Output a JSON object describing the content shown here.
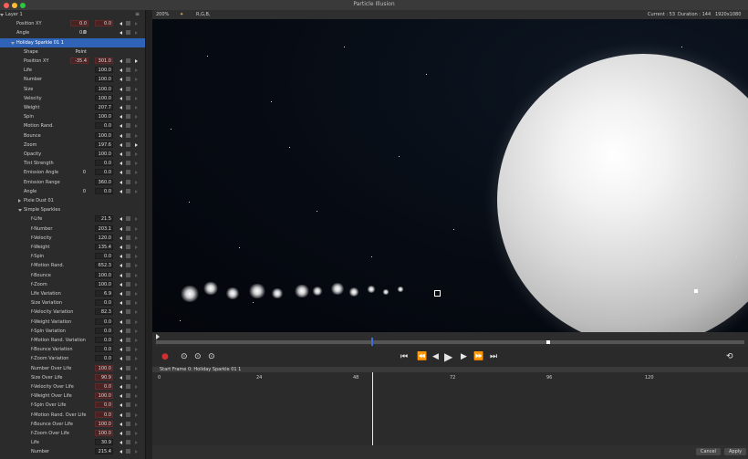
{
  "app": {
    "title": "Particle Illusion"
  },
  "toolbar": {
    "zoom": "200%",
    "mode": "R,G,B,",
    "current": "Current : 53",
    "duration": "Duration : 144",
    "resolution": "1920x1080"
  },
  "layers": [
    {
      "label": "Layer 1",
      "indent": 6,
      "tri": "down"
    },
    {
      "label": "Position XY",
      "indent": 18,
      "v1": "0.0",
      "v2": "0.0",
      "red": true,
      "kf": true,
      "sq": true,
      "ar": "off"
    },
    {
      "label": "Angle",
      "indent": 18,
      "v0": "0",
      "v1": "0.0",
      "kf": true,
      "sq": true,
      "ar": "off"
    },
    {
      "label": "Holiday Sparkle 01 1",
      "indent": 18,
      "tri": "down",
      "selected": true
    },
    {
      "label": "Shape",
      "indent": 26,
      "v1": "Point"
    },
    {
      "label": "Position XY",
      "indent": 26,
      "v1": "-35.4",
      "v2": "301.0",
      "red": true,
      "kf": true,
      "sq": true,
      "ar": "on"
    },
    {
      "label": "Life",
      "indent": 26,
      "v2": "100.0",
      "kf": true,
      "sq": true,
      "ar": "off"
    },
    {
      "label": "Number",
      "indent": 26,
      "v2": "100.0",
      "kf": true,
      "sq": true,
      "ar": "off"
    },
    {
      "label": "Size",
      "indent": 26,
      "v2": "100.0",
      "kf": true,
      "sq": true,
      "ar": "off"
    },
    {
      "label": "Velocity",
      "indent": 26,
      "v2": "100.0",
      "kf": true,
      "sq": true,
      "ar": "off"
    },
    {
      "label": "Weight",
      "indent": 26,
      "v2": "207.7",
      "kf": true,
      "sq": true,
      "ar": "off"
    },
    {
      "label": "Spin",
      "indent": 26,
      "v2": "100.0",
      "kf": true,
      "sq": true,
      "ar": "off"
    },
    {
      "label": "Motion Rand.",
      "indent": 26,
      "v2": "0.0",
      "kf": true,
      "sq": true,
      "ar": "off"
    },
    {
      "label": "Bounce",
      "indent": 26,
      "v2": "100.0",
      "kf": true,
      "sq": true,
      "ar": "off"
    },
    {
      "label": "Zoom",
      "indent": 26,
      "v2": "197.6",
      "kf": true,
      "sq": true,
      "ar": "on"
    },
    {
      "label": "Opacity",
      "indent": 26,
      "v2": "100.0",
      "kf": true,
      "sq": true,
      "ar": "off"
    },
    {
      "label": "Tint Strength",
      "indent": 26,
      "v2": "0.0",
      "kf": true,
      "sq": true,
      "ar": "off"
    },
    {
      "label": "Emission Angle",
      "indent": 26,
      "v0": "0",
      "v2": "0.0",
      "kf": true,
      "sq": true,
      "ar": "off"
    },
    {
      "label": "Emission Range",
      "indent": 26,
      "v2": "360.0",
      "kf": true,
      "sq": true,
      "ar": "off"
    },
    {
      "label": "Angle",
      "indent": 26,
      "v0": "0",
      "v2": "0.0",
      "kf": true,
      "sq": true,
      "ar": "off"
    },
    {
      "label": "Pixie Dust 01",
      "indent": 26,
      "tri": "right"
    },
    {
      "label": "Simple Sparkles",
      "indent": 26,
      "tri": "down"
    },
    {
      "label": "f-Life",
      "indent": 34,
      "v2": "21.5",
      "kf": true,
      "sq": true,
      "ar": "off"
    },
    {
      "label": "f-Number",
      "indent": 34,
      "v2": "203.1",
      "kf": true,
      "sq": true,
      "ar": "off"
    },
    {
      "label": "f-Velocity",
      "indent": 34,
      "v2": "120.0",
      "kf": true,
      "sq": true,
      "ar": "off"
    },
    {
      "label": "f-Weight",
      "indent": 34,
      "v2": "135.4",
      "kf": true,
      "sq": true,
      "ar": "off"
    },
    {
      "label": "f-Spin",
      "indent": 34,
      "v2": "0.0",
      "kf": true,
      "sq": true,
      "ar": "off"
    },
    {
      "label": "f-Motion Rand.",
      "indent": 34,
      "v2": "652.3",
      "kf": true,
      "sq": true,
      "ar": "off"
    },
    {
      "label": "f-Bounce",
      "indent": 34,
      "v2": "100.0",
      "kf": true,
      "sq": true,
      "ar": "off"
    },
    {
      "label": "f-Zoom",
      "indent": 34,
      "v2": "100.0",
      "kf": true,
      "sq": true,
      "ar": "off"
    },
    {
      "label": "Life Variation",
      "indent": 34,
      "v2": "6.9",
      "kf": true,
      "sq": true,
      "ar": "off"
    },
    {
      "label": "Size Variation",
      "indent": 34,
      "v2": "0.0",
      "kf": true,
      "sq": true,
      "ar": "off"
    },
    {
      "label": "f-Velocity Variation",
      "indent": 34,
      "v2": "82.3",
      "kf": true,
      "sq": true,
      "ar": "off"
    },
    {
      "label": "f-Weight Variation",
      "indent": 34,
      "v2": "0.0",
      "kf": true,
      "sq": true,
      "ar": "off"
    },
    {
      "label": "f-Spin Variation",
      "indent": 34,
      "v2": "0.0",
      "kf": true,
      "sq": true,
      "ar": "off"
    },
    {
      "label": "f-Motion Rand. Variation",
      "indent": 34,
      "v2": "0.0",
      "kf": true,
      "sq": true,
      "ar": "off"
    },
    {
      "label": "f-Bounce Variation",
      "indent": 34,
      "v2": "0.0",
      "kf": true,
      "sq": true,
      "ar": "off"
    },
    {
      "label": "f-Zoom Variation",
      "indent": 34,
      "v2": "0.0",
      "kf": true,
      "sq": true,
      "ar": "off"
    },
    {
      "label": "Number Over Life",
      "indent": 34,
      "v2": "100.0",
      "red": true,
      "kf": true,
      "sq": true,
      "ar": "off"
    },
    {
      "label": "Size Over Life",
      "indent": 34,
      "v2": "90.9",
      "red": true,
      "kf": true,
      "sq": true,
      "ar": "off"
    },
    {
      "label": "f-Velocity Over Life",
      "indent": 34,
      "v2": "0.0",
      "red": true,
      "kf": true,
      "sq": true,
      "ar": "off"
    },
    {
      "label": "f-Weight Over Life",
      "indent": 34,
      "v2": "100.0",
      "red": true,
      "kf": true,
      "sq": true,
      "ar": "off"
    },
    {
      "label": "f-Spin Over Life",
      "indent": 34,
      "v2": "0.0",
      "red": true,
      "kf": true,
      "sq": true,
      "ar": "off"
    },
    {
      "label": "f-Motion Rand. Over Life",
      "indent": 34,
      "v2": "0.0",
      "red": true,
      "kf": true,
      "sq": true,
      "ar": "off"
    },
    {
      "label": "f-Bounce Over Life",
      "indent": 34,
      "v2": "100.0",
      "red": true,
      "kf": true,
      "sq": true,
      "ar": "off"
    },
    {
      "label": "f-Zoom Over Life",
      "indent": 34,
      "v2": "100.0",
      "red": true,
      "kf": true,
      "sq": true,
      "ar": "off"
    },
    {
      "label": "Life",
      "indent": 34,
      "v2": "30.9",
      "kf": true,
      "sq": true,
      "ar": "off"
    },
    {
      "label": "Number",
      "indent": 34,
      "v2": "215.4",
      "kf": true,
      "sq": true,
      "ar": "off"
    }
  ],
  "timeline": {
    "header": "Start Frame 0: Holiday Sparkle 01 1",
    "ticks": [
      "0",
      "24",
      "48",
      "72",
      "96",
      "120"
    ]
  },
  "footer": {
    "cancel": "Cancel",
    "apply": "Apply"
  },
  "colors": {
    "selection": "#2e63b8",
    "record": "#d03030",
    "playhead": "#3b6fd6"
  }
}
